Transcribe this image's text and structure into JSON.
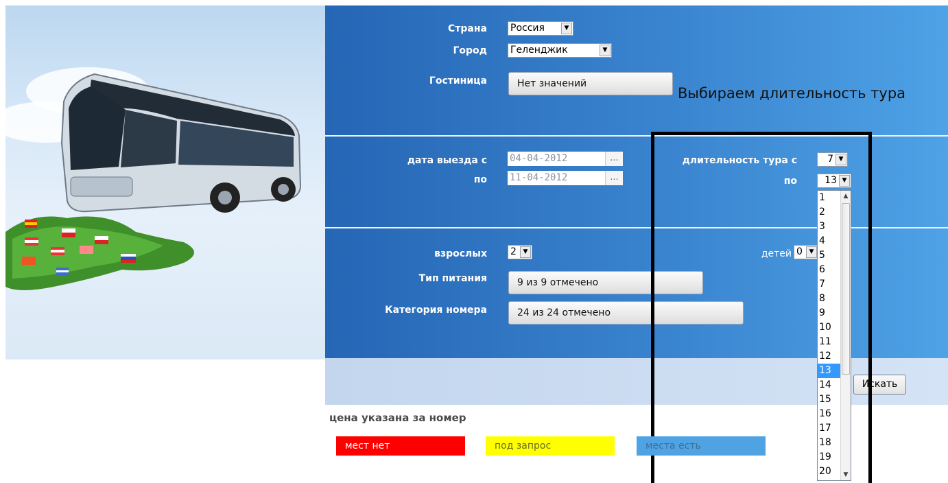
{
  "annotation": {
    "title": "Выбираем длительность тура"
  },
  "form": {
    "country": {
      "label": "Страна",
      "value": "Россия"
    },
    "city": {
      "label": "Город",
      "value": "Геленджик"
    },
    "hotel": {
      "label": "Гостиница",
      "value": "Нет значений"
    },
    "date_from": {
      "label": "дата выезда с",
      "value": "04-04-2012",
      "picker": "..."
    },
    "date_to": {
      "label": "по",
      "value": "11-04-2012",
      "picker": "..."
    },
    "duration_from": {
      "label": "длительность тура с",
      "value": "7"
    },
    "duration_to": {
      "label": "по",
      "value": "13"
    },
    "adults": {
      "label": "взрослых",
      "value": "2"
    },
    "children": {
      "label": "детей",
      "value": "0"
    },
    "meal": {
      "label": "Тип питания",
      "value": "9 из 9 отмечено"
    },
    "room": {
      "label": "Категория номера",
      "value": "24 из 24 отмечено"
    }
  },
  "duration_dropdown": {
    "options": [
      "1",
      "2",
      "3",
      "4",
      "5",
      "6",
      "7",
      "8",
      "9",
      "10",
      "11",
      "12",
      "13",
      "14",
      "15",
      "16",
      "17",
      "18",
      "19",
      "20"
    ],
    "selected": "13"
  },
  "search_button": {
    "label": "Искать"
  },
  "price_note": "цена указана за номер",
  "legend": [
    {
      "label": "мест нет",
      "color": "#ff0000",
      "text_color": "#ffffff"
    },
    {
      "label": "под запрос",
      "color": "#ffff00",
      "text_color": "#6a6a2a"
    },
    {
      "label": "места есть",
      "color": "#4fa3e3",
      "text_color": "#3f6f9a"
    }
  ]
}
